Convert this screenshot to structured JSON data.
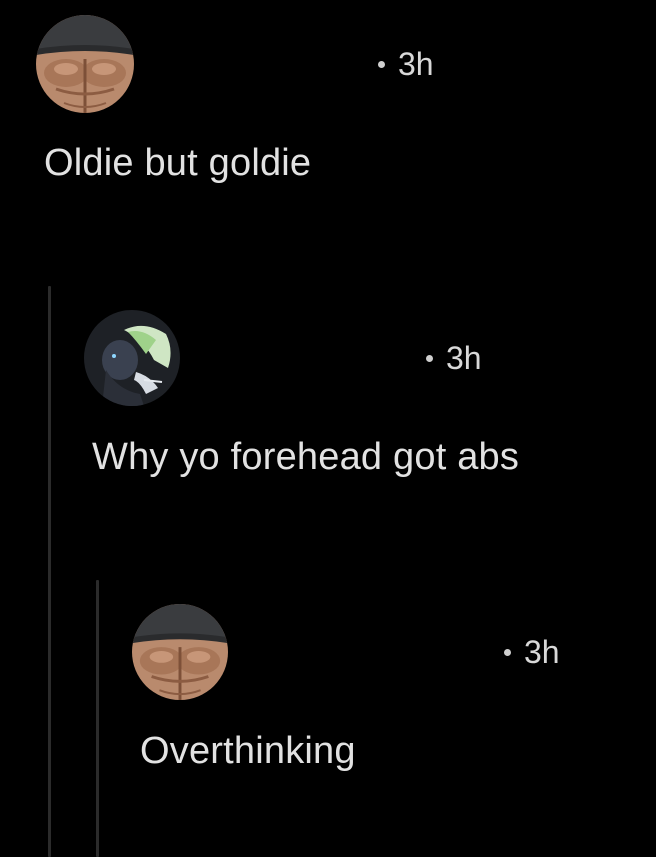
{
  "comments": [
    {
      "username": "",
      "timestamp": "3h",
      "text": "Oldie but goldie",
      "avatar_icon": "muscle-torso-icon"
    },
    {
      "username": "",
      "timestamp": "3h",
      "text": "Why yo forehead got abs",
      "avatar_icon": "anime-character-icon"
    },
    {
      "username": "",
      "timestamp": "3h",
      "text": "Overthinking",
      "avatar_icon": "muscle-torso-icon"
    }
  ],
  "colors": {
    "background": "#000000",
    "text": "#e2e2e2",
    "meta": "#d8d8d8",
    "thread_line": "#2b2b2b"
  }
}
